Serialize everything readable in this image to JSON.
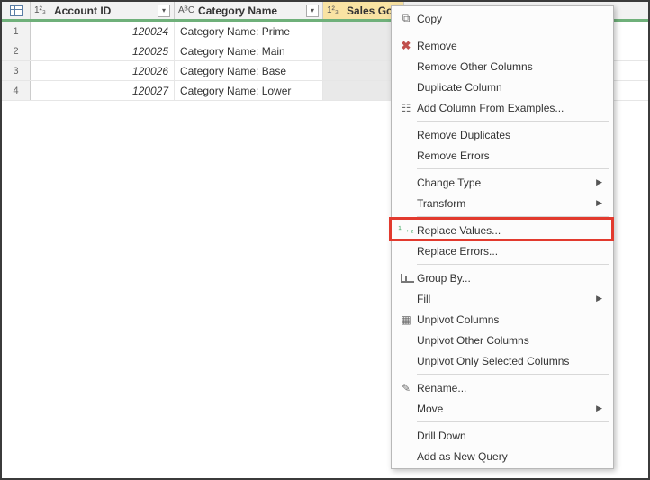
{
  "columns": {
    "account_id": {
      "label": "Account ID",
      "type_icon": "1²₃"
    },
    "category_name": {
      "label": "Category Name",
      "type_icon": "AᴮC"
    },
    "sales_goal": {
      "label": "Sales Goal",
      "type_icon": "1²₃"
    }
  },
  "rows": [
    {
      "num": "1",
      "account_id": "120024",
      "category_name": "Category Name: Prime"
    },
    {
      "num": "2",
      "account_id": "120025",
      "category_name": "Category Name: Main"
    },
    {
      "num": "3",
      "account_id": "120026",
      "category_name": "Category Name: Base"
    },
    {
      "num": "4",
      "account_id": "120027",
      "category_name": "Category Name: Lower"
    }
  ],
  "menu": {
    "copy": "Copy",
    "remove": "Remove",
    "remove_other_columns": "Remove Other Columns",
    "duplicate_column": "Duplicate Column",
    "add_column_from_examples": "Add Column From Examples...",
    "remove_duplicates": "Remove Duplicates",
    "remove_errors": "Remove Errors",
    "change_type": "Change Type",
    "transform": "Transform",
    "replace_values": "Replace Values...",
    "replace_errors": "Replace Errors...",
    "group_by": "Group By...",
    "fill": "Fill",
    "unpivot_columns": "Unpivot Columns",
    "unpivot_other_columns": "Unpivot Other Columns",
    "unpivot_only_selected": "Unpivot Only Selected Columns",
    "rename": "Rename...",
    "move": "Move",
    "drill_down": "Drill Down",
    "add_as_new_query": "Add as New Query"
  }
}
